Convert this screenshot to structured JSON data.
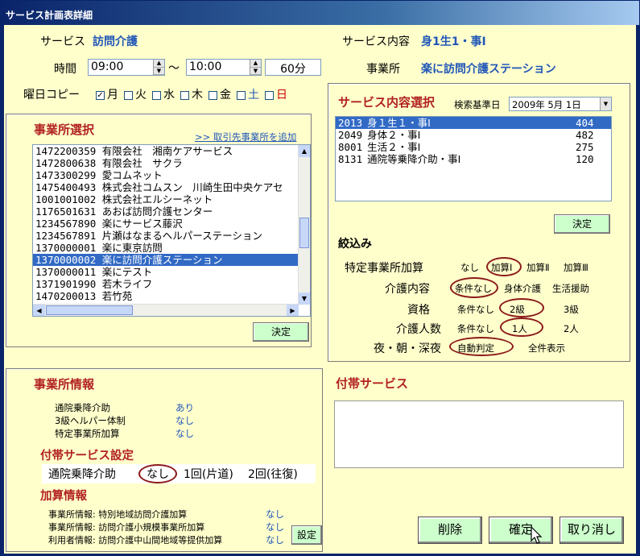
{
  "window": {
    "title": "サービス計画表詳細"
  },
  "header": {
    "service_label": "サービス",
    "service_value": "訪問介護",
    "time_label": "時間",
    "start_time": "09:00",
    "tilde": "～",
    "end_time": "10:00",
    "duration": "60分",
    "content_label": "サービス内容",
    "content_value": "身1生1・事Ⅰ",
    "office_label": "事業所",
    "office_value": "楽に訪問介護ステーション"
  },
  "weekday": {
    "label": "曜日コピー",
    "days": [
      {
        "name": "月",
        "checked": true
      },
      {
        "name": "火",
        "checked": false
      },
      {
        "name": "水",
        "checked": false
      },
      {
        "name": "木",
        "checked": false
      },
      {
        "name": "金",
        "checked": false
      },
      {
        "name": "土",
        "checked": false
      },
      {
        "name": "日",
        "checked": false
      }
    ],
    "check_mark": "✓"
  },
  "office_select": {
    "title": "事業所選択",
    "add_link": ">> 取引先事業所を追加",
    "items": [
      "1472200359 有限会社　湘南ケアサービス",
      "1472800638 有限会社　サクラ",
      "1473300299 愛コムネット",
      "1475400493 株式会社コムスン　川崎生田中央ケアセ",
      "1001001002 株式会社エルシーネット",
      "1176501631 あおば訪問介護センター",
      "1234567890 楽にサービス藤沢",
      "1234567891 片瀬はなまるヘルパーステーション",
      "1370000001 楽に東京訪問",
      "1370000002 楽に訪問介護ステーション",
      "1370000011 楽にテスト",
      "1371901990 若木ライフ",
      "1470200013 若竹苑"
    ],
    "selected_index": 9,
    "confirm": "決定"
  },
  "service_select": {
    "title": "サービス内容選択",
    "date_label": "検索基準日",
    "date_value": "2009年 5月 1日",
    "items": [
      {
        "code": "2013",
        "name": "身１生１・事Ⅰ",
        "units": "404"
      },
      {
        "code": "2049",
        "name": "身体２・事Ⅰ",
        "units": "482"
      },
      {
        "code": "8001",
        "name": "生活２・事Ⅰ",
        "units": "275"
      },
      {
        "code": "8131",
        "name": "通院等乗降介助・事Ⅰ",
        "units": "120"
      }
    ],
    "selected_index": 0,
    "confirm": "決定"
  },
  "filter": {
    "title": "絞込み",
    "rows": [
      {
        "label": "特定事業所加算",
        "options": [
          "なし",
          "加算Ⅰ",
          "加算Ⅱ",
          "加算Ⅲ"
        ]
      },
      {
        "label": "介護内容",
        "options": [
          "条件なし",
          "身体介護",
          "生活援助"
        ]
      },
      {
        "label": "資格",
        "options": [
          "条件なし",
          "2級",
          "3級"
        ]
      },
      {
        "label": "介護人数",
        "options": [
          "条件なし",
          "1人",
          "2人"
        ]
      },
      {
        "label": "夜・朝・深夜",
        "options": [
          "自動判定",
          "全件表示"
        ]
      }
    ]
  },
  "office_info": {
    "title": "事業所情報",
    "rows": [
      {
        "label": "通院乗降介助",
        "value": "あり"
      },
      {
        "label": "3級ヘルパー体制",
        "value": "なし"
      },
      {
        "label": "特定事業所加算",
        "value": "なし"
      }
    ]
  },
  "attached_setting": {
    "title": "付帯サービス設定",
    "label": "通院乗降介助",
    "options": [
      "なし",
      "1回(片道)",
      "2回(往復)"
    ]
  },
  "addition_info": {
    "title": "加算情報",
    "rows": [
      {
        "label": "事業所情報: 特別地域訪問介護加算",
        "value": "なし"
      },
      {
        "label": "事業所情報: 訪問介護小規模事業所加算",
        "value": "なし"
      },
      {
        "label": "利用者情報: 訪問介護中山間地域等提供加算",
        "value": "なし"
      }
    ],
    "setting_button": "設定"
  },
  "attached_service": {
    "title": "付帯サービス"
  },
  "actions": {
    "delete": "削除",
    "confirm": "確定",
    "cancel": "取り消し"
  },
  "colors": {
    "background": "#ffffcc",
    "section_title": "#b22222",
    "link": "#2156b8",
    "button": "#ccffcc",
    "selection": "#316ac5"
  }
}
